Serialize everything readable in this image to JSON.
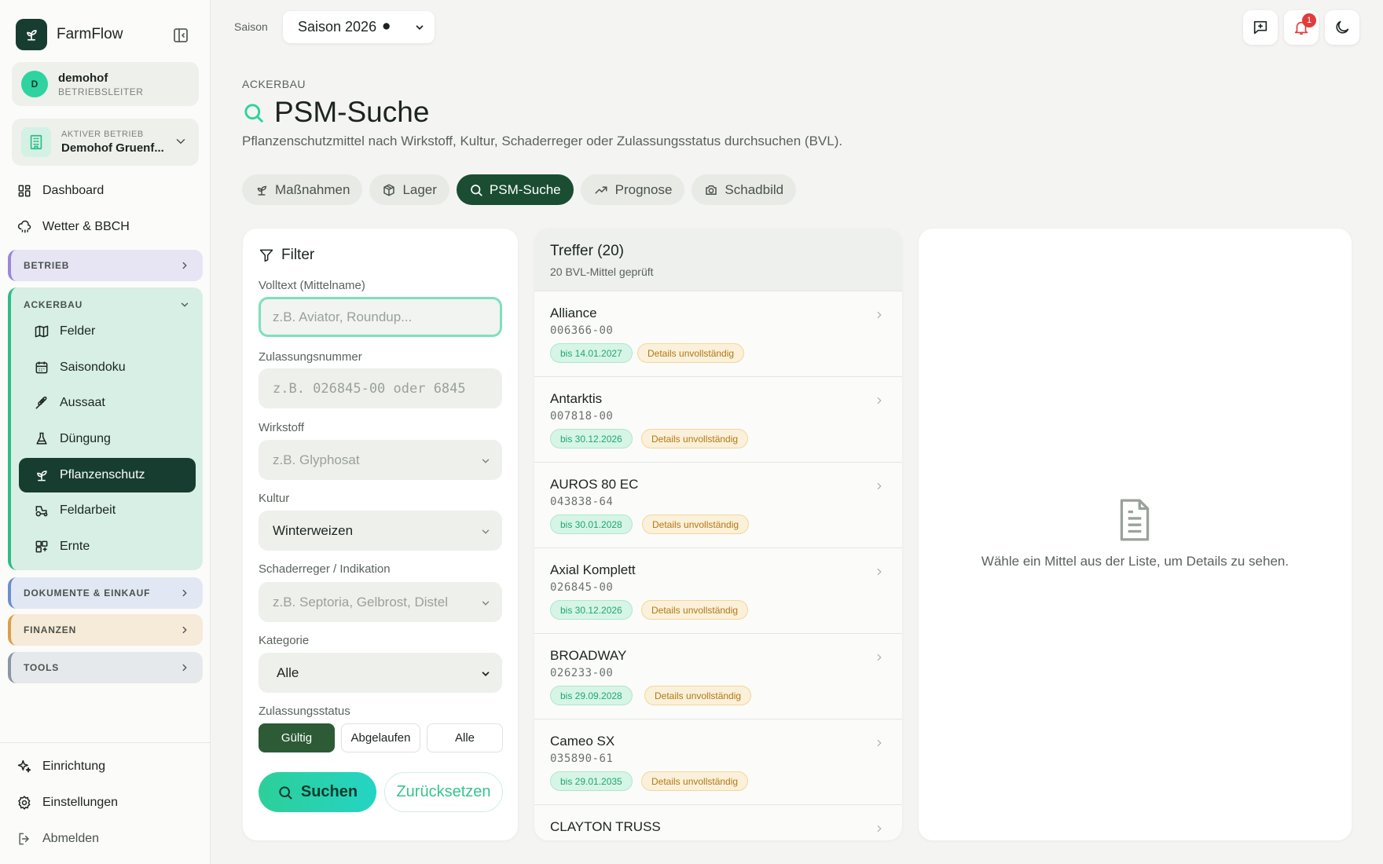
{
  "app": {
    "name": "FarmFlow"
  },
  "user": {
    "initial": "D",
    "name": "demohof",
    "role": "BETRIEBSLEITER"
  },
  "farm": {
    "label": "AKTIVER BETRIEB",
    "name": "Demohof Gruenf..."
  },
  "nav": {
    "dashboard": "Dashboard",
    "weather": "Wetter & BBCH",
    "groups": {
      "betrieb": "BETRIEB",
      "ackerbau": "ACKERBAU",
      "dokumente": "DOKUMENTE & EINKAUF",
      "finanzen": "FINANZEN",
      "tools": "TOOLS"
    },
    "ackerbau_items": [
      {
        "label": "Felder",
        "icon": "map-icon"
      },
      {
        "label": "Saisondoku",
        "icon": "calendar-icon"
      },
      {
        "label": "Aussaat",
        "icon": "wheat-icon"
      },
      {
        "label": "Düngung",
        "icon": "flask-icon"
      },
      {
        "label": "Pflanzenschutz",
        "icon": "sprout-icon"
      },
      {
        "label": "Feldarbeit",
        "icon": "tractor-icon"
      },
      {
        "label": "Ernte",
        "icon": "harvest-icon"
      }
    ],
    "bottom": {
      "setup": "Einrichtung",
      "settings": "Einstellungen",
      "logout": "Abmelden"
    }
  },
  "header": {
    "season_label": "Saison",
    "season_value": "Saison 2026 ⚫",
    "notification_count": "1"
  },
  "page": {
    "breadcrumb": "ACKERBAU",
    "title": "PSM-Suche",
    "subtitle": "Pflanzenschutzmittel nach Wirkstoff, Kultur, Schaderreger oder Zulassungsstatus durchsuchen (BVL)."
  },
  "tabs": [
    {
      "label": "Maßnahmen",
      "icon": "sprout-icon"
    },
    {
      "label": "Lager",
      "icon": "package-icon"
    },
    {
      "label": "PSM-Suche",
      "icon": "search-icon"
    },
    {
      "label": "Prognose",
      "icon": "trend-icon"
    },
    {
      "label": "Schadbild",
      "icon": "camera-icon"
    }
  ],
  "filter": {
    "title": "Filter",
    "fulltext_label": "Volltext (Mittelname)",
    "fulltext_placeholder": "z.B. Aviator, Roundup...",
    "regnum_label": "Zulassungsnummer",
    "regnum_placeholder": "z.B. 026845-00 oder 6845",
    "substance_label": "Wirkstoff",
    "substance_placeholder": "z.B. Glyphosat",
    "crop_label": "Kultur",
    "crop_value": "Winterweizen",
    "pest_label": "Schaderreger / Indikation",
    "pest_placeholder": "z.B. Septoria, Gelbrost, Distel",
    "category_label": "Kategorie",
    "category_value": "Alle",
    "status_label": "Zulassungsstatus",
    "status_options": [
      "Gültig",
      "Abgelaufen",
      "Alle"
    ],
    "search_button": "Suchen",
    "reset_button": "Zurücksetzen"
  },
  "results": {
    "title": "Treffer (20)",
    "subtitle": "20 BVL-Mittel geprüft",
    "warning_badge": "Details unvollständig",
    "items": [
      {
        "name": "Alliance",
        "number": "006366-00",
        "valid_until": "bis 14.01.2027"
      },
      {
        "name": "Antarktis",
        "number": "007818-00",
        "valid_until": "bis 30.12.2026"
      },
      {
        "name": "AUROS 80 EC",
        "number": "043838-64",
        "valid_until": "bis 30.01.2028"
      },
      {
        "name": "Axial Komplett",
        "number": "026845-00",
        "valid_until": "bis 30.12.2026"
      },
      {
        "name": "BROADWAY",
        "number": "026233-00",
        "valid_until": "bis 29.09.2028"
      },
      {
        "name": "Cameo SX",
        "number": "035890-61",
        "valid_until": "bis 29.01.2035"
      },
      {
        "name": "CLAYTON TRUSS",
        "number": "",
        "valid_until": ""
      }
    ]
  },
  "detail": {
    "empty_text": "Wähle ein Mittel aus der Liste, um Details zu sehen."
  },
  "colors": {
    "brand_dark": "#173d30",
    "accent": "#2ed3a0",
    "active_tab": "#1a4d31"
  }
}
